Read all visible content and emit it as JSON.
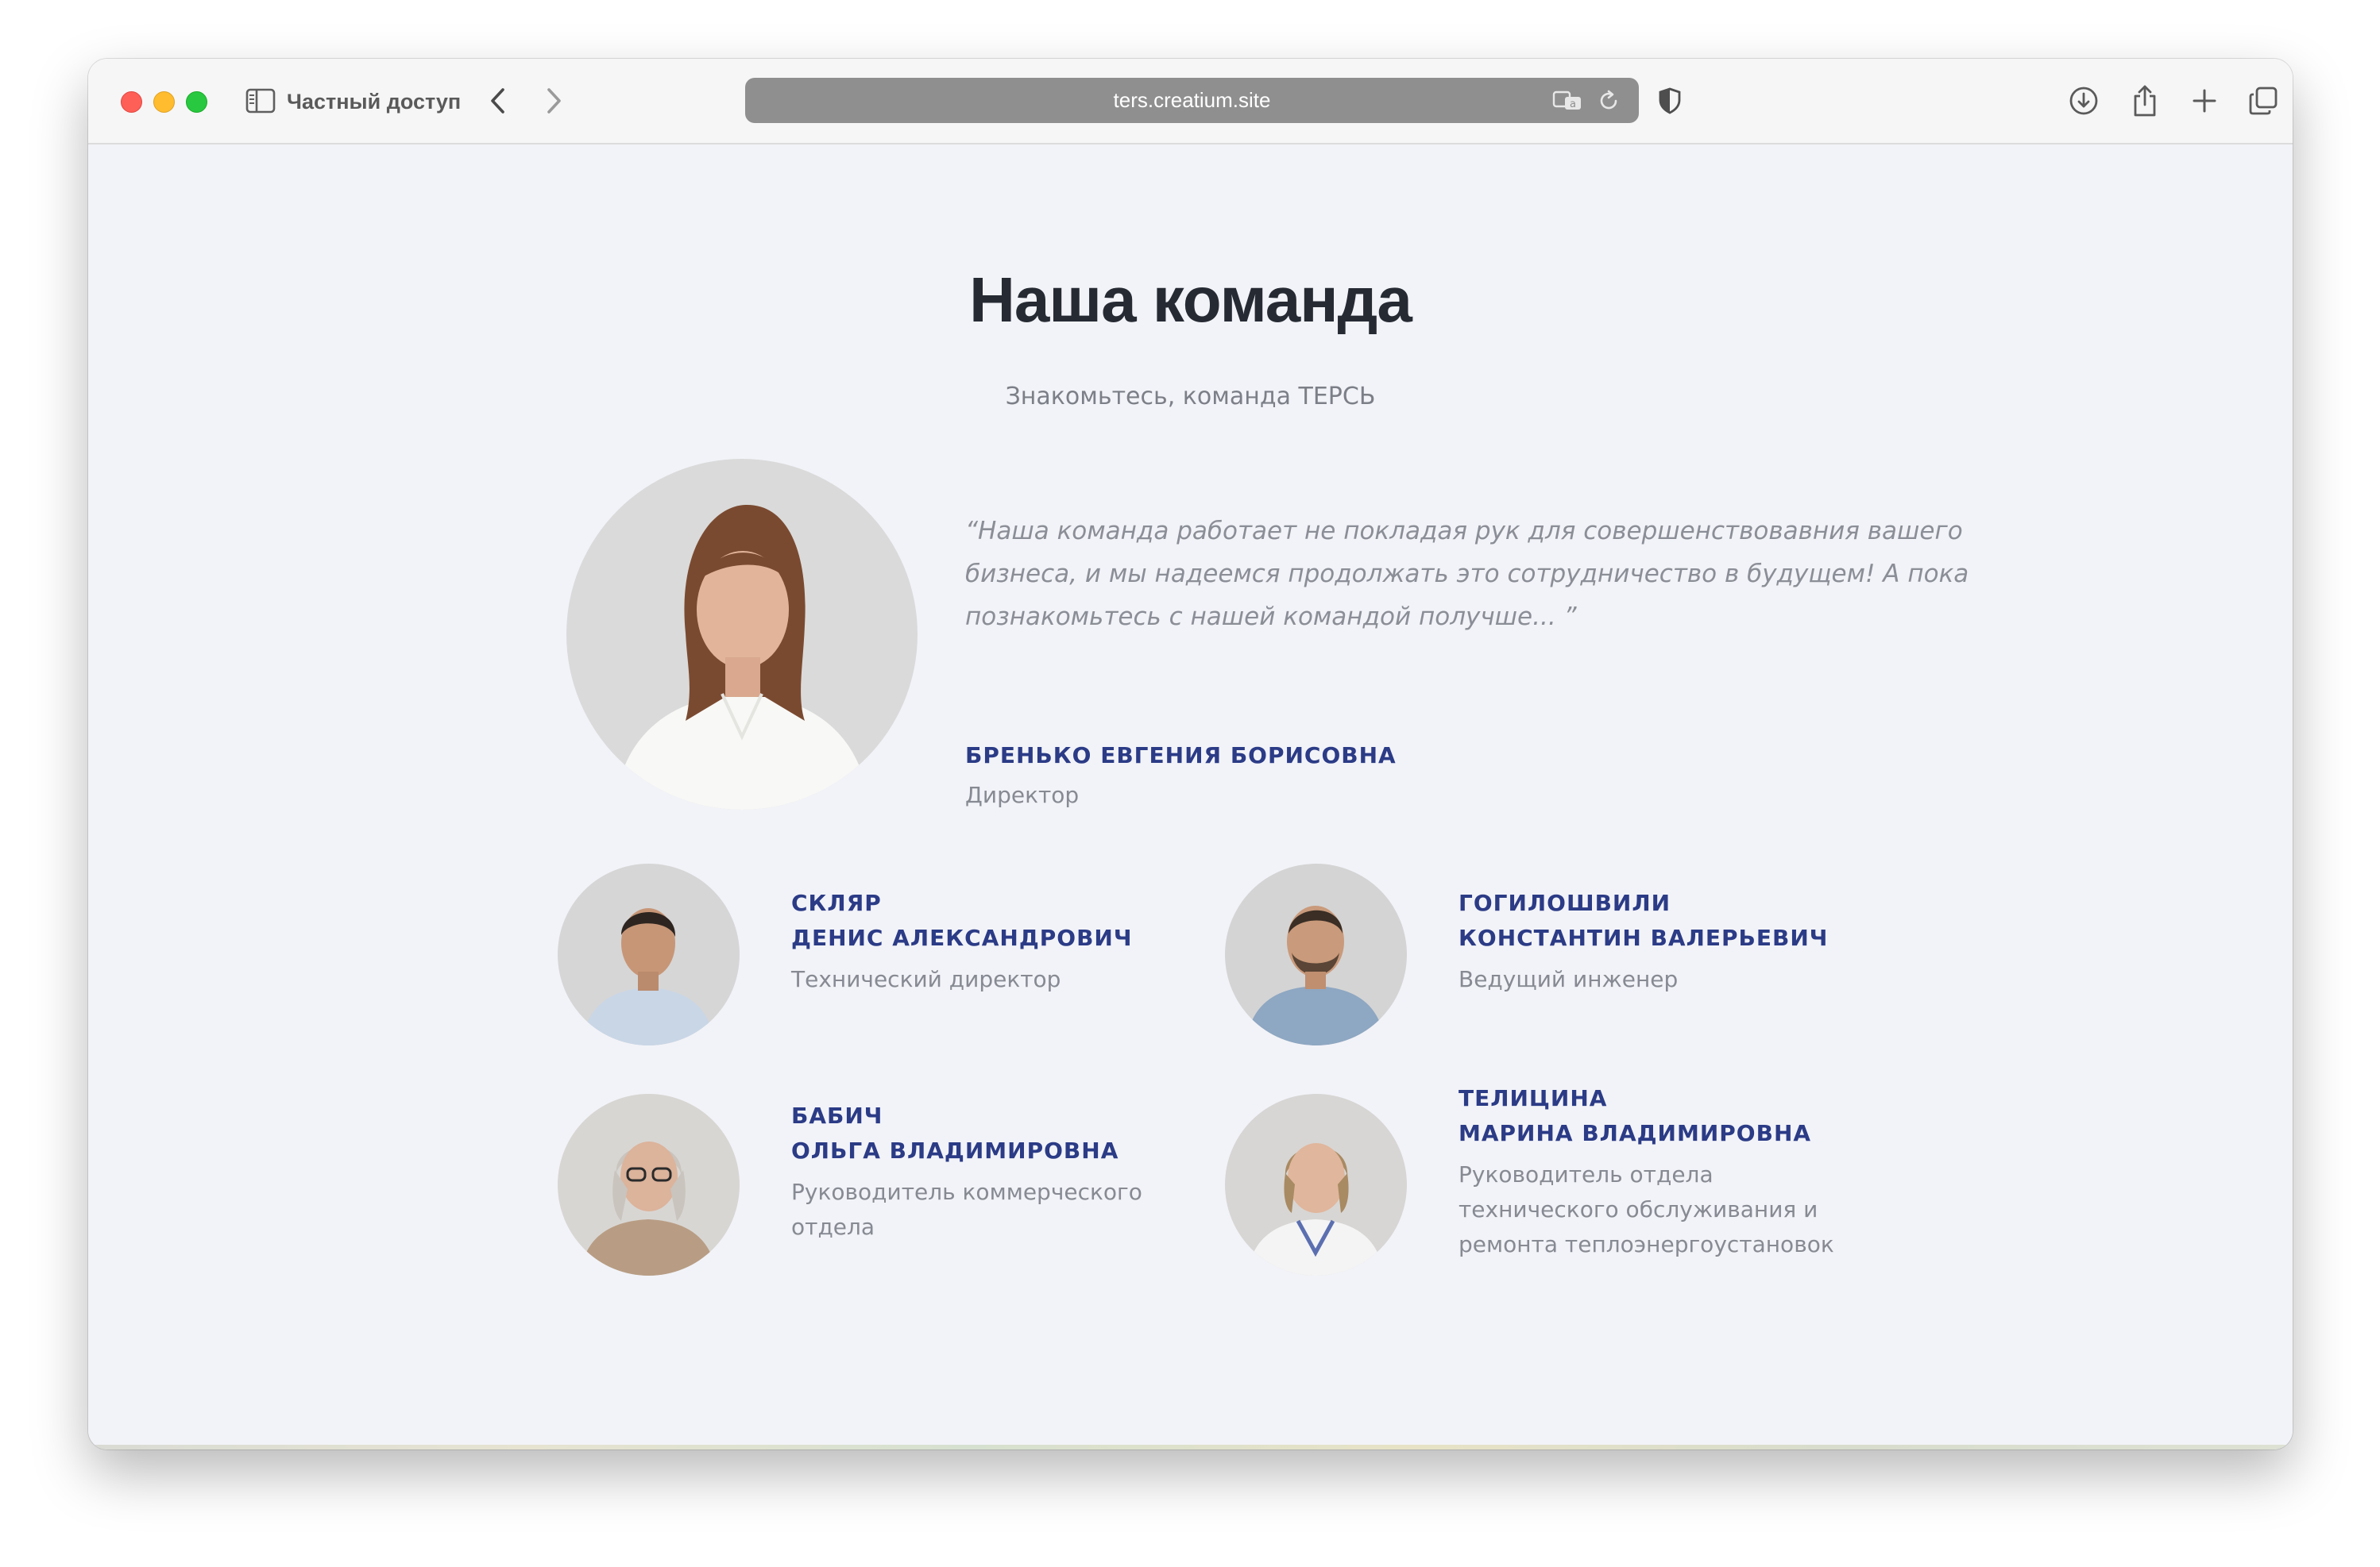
{
  "browser": {
    "private_label": "Частный доступ",
    "url": "ters.creatium.site"
  },
  "page": {
    "title": "Наша команда",
    "subtitle": "Знакомьтесь, команда ТЕРСЬ"
  },
  "director": {
    "quote_lines": [
      "“Наша команда работает не покладая рук для совершенствовавния вашего",
      "бизнеса, и мы надеемся продолжать это сотрудничество в будущем! А пока",
      "познакомьтесь с нашей командой получше... ”"
    ],
    "name": "БРЕНЬКО ЕВГЕНИЯ БОРИСОВНА",
    "role": "Директор"
  },
  "team": [
    {
      "surname": "СКЛЯР",
      "given": "ДЕНИС АЛЕКСАНДРОВИЧ",
      "role_lines": [
        "Технический директор"
      ]
    },
    {
      "surname": "ГОГИЛОШВИЛИ",
      "given": "КОНСТАНТИН ВАЛЕРЬЕВИЧ",
      "role_lines": [
        "Ведущий инженер"
      ]
    },
    {
      "surname": "БАБИЧ",
      "given": "ОЛЬГА ВЛАДИМИРОВНА",
      "role_lines": [
        "Руководитель коммерческого",
        "отдела"
      ]
    },
    {
      "surname": "ТЕЛИЦИНА",
      "given": "МАРИНА ВЛАДИМИРОВНА",
      "role_lines": [
        "Руководитель отдела",
        "технического обслуживания и",
        "ремонта теплоэнергоустановок"
      ]
    }
  ],
  "colors": {
    "page_background": "#f2f3f8",
    "name_color": "#2b3b86",
    "title_color": "#262a33",
    "muted_text": "#878a92"
  }
}
